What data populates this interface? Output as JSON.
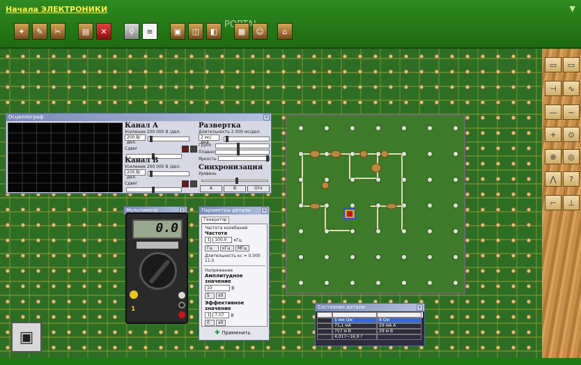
{
  "app": {
    "title": "Начала ЭЛЕКТРОНИКИ",
    "watermark": "PORTAL",
    "menu_arrow": "▼"
  },
  "toolbar": {
    "buttons": [
      "new-icon",
      "open-icon",
      "tools-icon",
      "save-icon",
      "delete-icon",
      "search-icon",
      "document-icon",
      "print-icon",
      "window-icon",
      "book-icon",
      "calculator-icon",
      "person-icon",
      "exit-icon"
    ]
  },
  "oscilloscope": {
    "title": "Осциллограф",
    "channel_a": {
      "heading": "Канал А",
      "sensitivity": "Усиление 200 000 В /дел.",
      "select": "200.В/дел.",
      "offset_label": "Сдвиг"
    },
    "channel_b": {
      "heading": "Канал В",
      "sensitivity": "Усиление 200 000 В /дел.",
      "select": "200.В/дел.",
      "offset_label": "Сдвиг"
    },
    "sweep": {
      "heading": "Развертка",
      "duration": "Длительность 2 000 мс/дел.",
      "select": "2 мс/дел.",
      "coarse": "Грубо",
      "fine": "Плавно",
      "brightness": "Яркость"
    },
    "sync": {
      "heading": "Синхронизация",
      "level": "Уровень",
      "buttons": [
        "A",
        "B",
        "Отк"
      ]
    }
  },
  "multimeter": {
    "title": "Мультиметр",
    "reading": "0.0",
    "mode_label": "1"
  },
  "part_params": {
    "title": "Параметры детали",
    "tab": "Генератор",
    "freq_group": "Частота колебаний",
    "freq_label": "Частота",
    "freq_value": "100.0",
    "freq_unit": "кГц",
    "unit_buttons": [
      "Гц",
      "кГц",
      "МГц"
    ],
    "period_text": "Длительность кс = 0.000 11.0",
    "voltage_group": "Напряжение",
    "amplitude_label": "Амплитудное значение",
    "amplitude_value": "10",
    "amplitude_unit": "В",
    "amp_buttons": [
      "5",
      "x0"
    ],
    "effective_label": "Эффективное значение",
    "effective_value": "7.07",
    "effective_unit": "В",
    "eff_buttons": [
      "0",
      "x0"
    ],
    "apply": "Применить"
  },
  "part_state": {
    "title": "Состояние детали",
    "rows": [
      [
        "",
        "",
        ""
      ],
      [
        "",
        "1 мм Ом",
        "8 Ом"
      ],
      [
        "",
        "75,1 мА",
        "29 мА А"
      ],
      [
        "",
        "757 м В",
        "29 м В"
      ],
      [
        "",
        "4,017~16,9 г",
        ""
      ]
    ]
  },
  "side_tools": [
    "switch-icon",
    "resistor-icon",
    "capacitor-icon",
    "coil-icon",
    "wire-icon",
    "wave-icon",
    "plus-icon",
    "circle-icon",
    "lamp-icon",
    "target-icon",
    "zigzag-icon",
    "help-icon",
    "graph-icon",
    "transistor-icon"
  ],
  "colors": {
    "pcb": "#2d6e24",
    "title": "#ffee44",
    "panel": "#d8d8e4",
    "titlebar": "#7a8ab8"
  }
}
